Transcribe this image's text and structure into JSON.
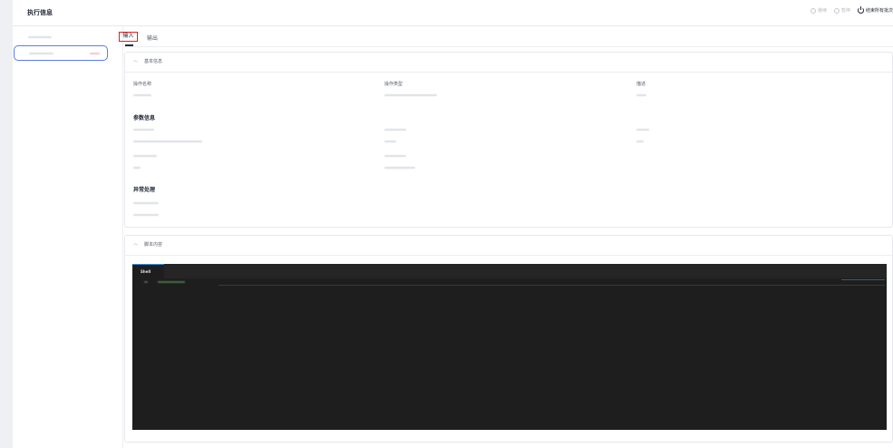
{
  "header": {
    "title": "执行信息",
    "actions": [
      {
        "label": "继续",
        "icon": "play-circle-icon",
        "enabled": false
      },
      {
        "label": "暂停",
        "icon": "pause-circle-icon",
        "enabled": false
      },
      {
        "label": "结束所有批次",
        "icon": "power-icon",
        "enabled": true
      }
    ]
  },
  "tabs": {
    "input": "输入",
    "output": "输出",
    "active": "输入"
  },
  "basic_info": {
    "section_title": "基本信息",
    "fields": {
      "op_name_label": "操作名称",
      "op_type_label": "操作类型",
      "desc_label": "描述"
    },
    "params_title": "参数信息",
    "exception_title": "异常处理"
  },
  "script": {
    "section_title": "脚本内容",
    "editor_tab": "Shell"
  },
  "colors": {
    "accent": "#5e7ce0",
    "highlight_border": "#e02020",
    "editor_bg": "#1e1e1e",
    "text_primary": "#252b3a"
  }
}
